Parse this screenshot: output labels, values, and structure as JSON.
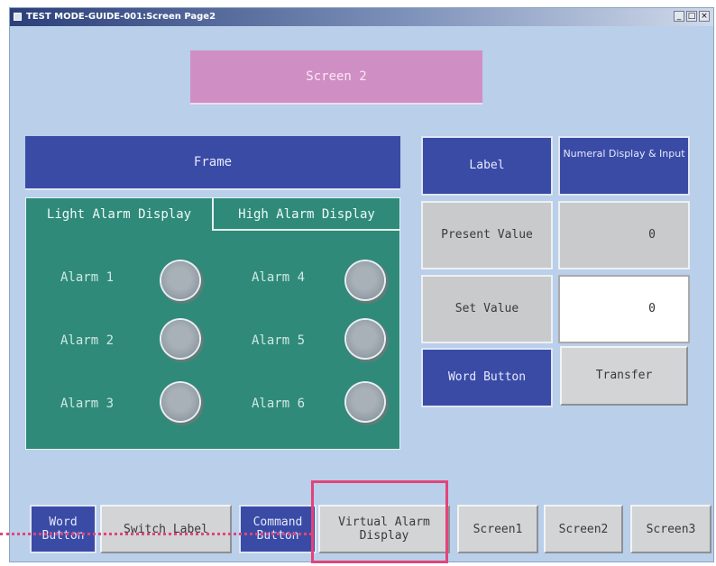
{
  "window": {
    "title": "TEST MODE-GUIDE-001:Screen Page2",
    "controls": [
      "_",
      "□",
      "×"
    ]
  },
  "screen_title": "Screen 2",
  "frame": {
    "header": "Frame",
    "tabs": [
      "Light Alarm Display",
      "High Alarm Display"
    ],
    "alarms": [
      "Alarm 1",
      "Alarm 2",
      "Alarm 3",
      "Alarm 4",
      "Alarm 5",
      "Alarm 6"
    ]
  },
  "right_panel": {
    "label_header": "Label",
    "numeral_header": "Numeral Display & Input",
    "present_value_label": "Present Value",
    "present_value": "0",
    "set_value_label": "Set Value",
    "set_value": "0",
    "word_button_label": "Word Button",
    "transfer_label": "Transfer"
  },
  "bottom_bar": {
    "word_button": "Word Button",
    "switch_label": "Switch Label",
    "command_button": "Command Button",
    "virtual_alarm": "Virtual Alarm Display",
    "screen1": "Screen1",
    "screen2": "Screen2",
    "screen3": "Screen3"
  },
  "colors": {
    "background": "#b9cfea",
    "blue_tile": "#3a4ba6",
    "teal_panel": "#2f8a7a",
    "screen_title_bg": "#d08fc4",
    "highlight": "#e2447a"
  },
  "icons": {
    "system_menu": "window-system-icon",
    "lamp": "alarm-lamp-icon"
  }
}
